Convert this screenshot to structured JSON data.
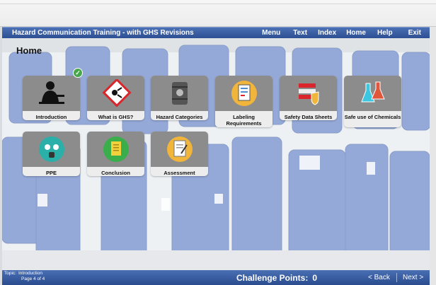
{
  "app": {
    "title": "Hazard Communication Training - with GHS Revisions"
  },
  "nav": [
    "Menu",
    "Text",
    "Index",
    "Home",
    "Help",
    "Exit"
  ],
  "page": {
    "title": "Home"
  },
  "modules": [
    {
      "label": "Introduction",
      "icon": "person-at-desk-icon",
      "completed": true
    },
    {
      "label": "What is GHS?",
      "icon": "ghs-hazard-diamond-icon",
      "completed": false
    },
    {
      "label": "Hazard Categories",
      "icon": "hazard-drum-icon",
      "completed": false
    },
    {
      "label": "Labeling Requirements",
      "icon": "clipboard-label-icon",
      "completed": false
    },
    {
      "label": "Safety Data Sheets",
      "icon": "sds-shield-icon",
      "completed": false
    },
    {
      "label": "Safe use of Chemicals",
      "icon": "chemical-flasks-icon",
      "completed": false
    },
    {
      "label": "PPE",
      "icon": "gas-mask-icon",
      "completed": false
    },
    {
      "label": "Conclusion",
      "icon": "document-icon",
      "completed": false
    },
    {
      "label": "Assessment",
      "icon": "assessment-notepad-icon",
      "completed": false
    }
  ],
  "footer": {
    "topic_label": "Topic:",
    "topic_value": "Introduction",
    "page_label": "Page 4 of 4",
    "challenge_label": "Challenge Points:",
    "challenge_points": "0",
    "back_label": "< Back",
    "next_label": "Next >"
  },
  "colors": {
    "bar": "#2d4f93",
    "tile": "#8c8c8c",
    "check": "#46a84a"
  }
}
